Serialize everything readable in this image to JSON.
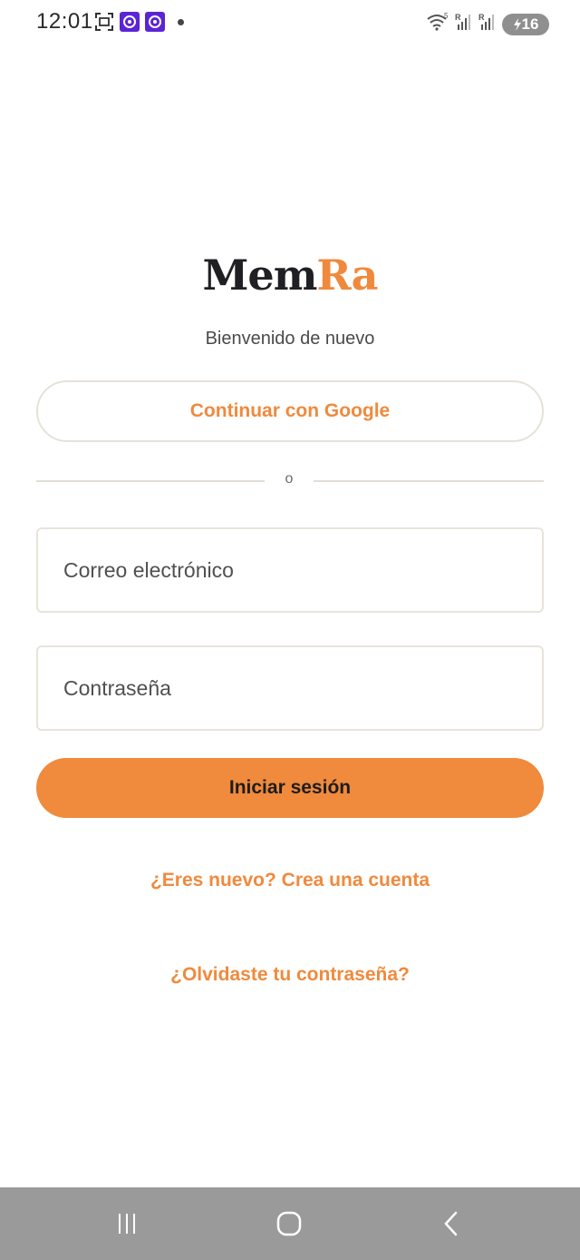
{
  "status_bar": {
    "time": "12:01",
    "battery": "16",
    "icons_left": [
      "screenshot-icon",
      "app-notification-icon",
      "app-notification-icon",
      "dot-icon"
    ],
    "icons_right": [
      "wifi-icon",
      "signal-icon",
      "signal-icon",
      "battery-icon"
    ]
  },
  "logo": {
    "part1": "Mem",
    "part2": "Ra"
  },
  "subtitle": "Bienvenido de nuevo",
  "google_button": "Continuar con Google",
  "divider_text": "o",
  "email": {
    "placeholder": "Correo electrónico",
    "value": ""
  },
  "password": {
    "placeholder": "Contraseña",
    "value": ""
  },
  "login_button": "Iniciar sesión",
  "signup_link": "¿Eres nuevo? Crea una cuenta",
  "forgot_link": "¿Olvidaste tu contraseña?",
  "nav_bar": {
    "icons": [
      "recent-apps-icon",
      "home-icon",
      "back-icon"
    ]
  },
  "colors": {
    "accent": "#f08a3c",
    "logo_dark": "#1f1f24",
    "nav_bar": "#9a9a9a",
    "status_badge": "#5b24d6"
  }
}
